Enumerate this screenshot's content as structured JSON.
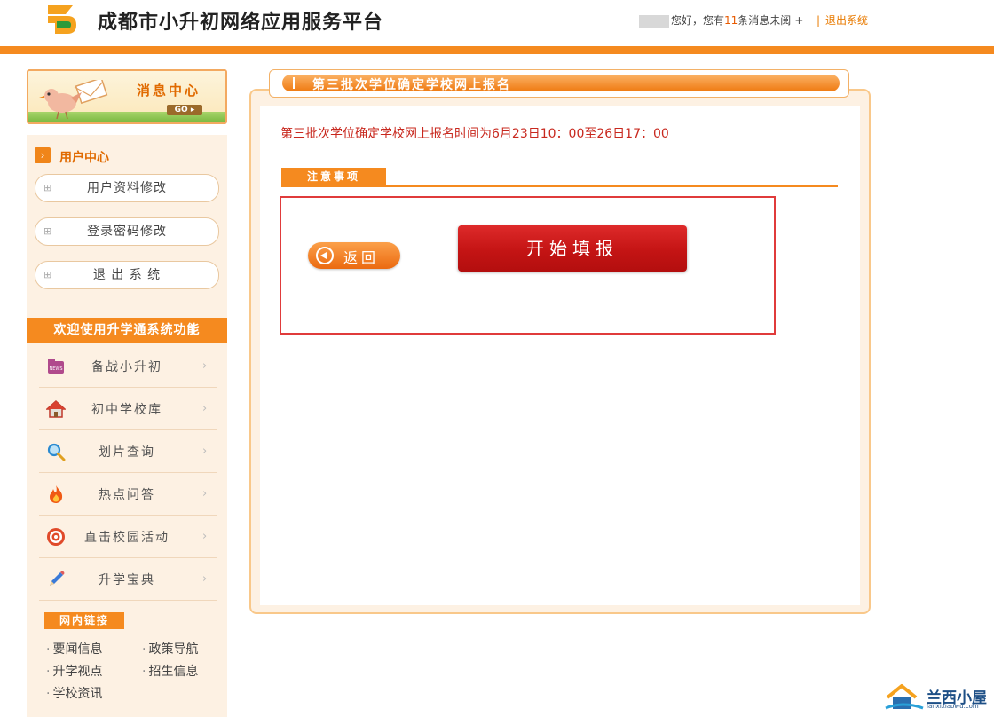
{
  "header": {
    "site_title": "成都市小升初网络应用服务平台",
    "greeting_pre": "您好，您有",
    "unread_count": "11",
    "greeting_post": "条消息未阅",
    "plus": "+",
    "separator": "|",
    "logout": "退出系统"
  },
  "message_center": {
    "title": "消息中心",
    "go": "GO"
  },
  "user_center": {
    "title": "用户中心",
    "buttons": [
      {
        "plus": "⊞",
        "label": "用户资料修改"
      },
      {
        "plus": "⊞",
        "label": "登录密码修改"
      },
      {
        "plus": "⊞",
        "label": "退 出 系 统"
      }
    ]
  },
  "functions": {
    "title": "欢迎使用升学通系统功能",
    "items": [
      {
        "label": "备战小升初",
        "icon": "news-icon"
      },
      {
        "label": "初中学校库",
        "icon": "house-icon"
      },
      {
        "label": "划片查询",
        "icon": "search-icon"
      },
      {
        "label": "热点问答",
        "icon": "fire-icon"
      },
      {
        "label": "直击校园活动",
        "icon": "target-icon"
      },
      {
        "label": "升学宝典",
        "icon": "pencil-icon"
      }
    ],
    "chevron": "›"
  },
  "internal_links": {
    "title": "网内链接",
    "dot": "·",
    "items": [
      "要闻信息",
      "政策导航",
      "升学视点",
      "招生信息",
      "学校资讯"
    ]
  },
  "main": {
    "tab_title": "第三批次学位确定学校网上报名",
    "notice": "第三批次学位确定学校网上报名时间为6月23日10：00至26日17：00",
    "attention_tab": "注意事项",
    "back_button": "返回",
    "start_button": "开始填报"
  },
  "watermark": {
    "text": "兰西小屋",
    "sub": "lanxixiaowu.com"
  },
  "colors": {
    "brand_orange": "#f58a1f",
    "notice_red": "#c8281e",
    "button_red": "#c41414"
  }
}
